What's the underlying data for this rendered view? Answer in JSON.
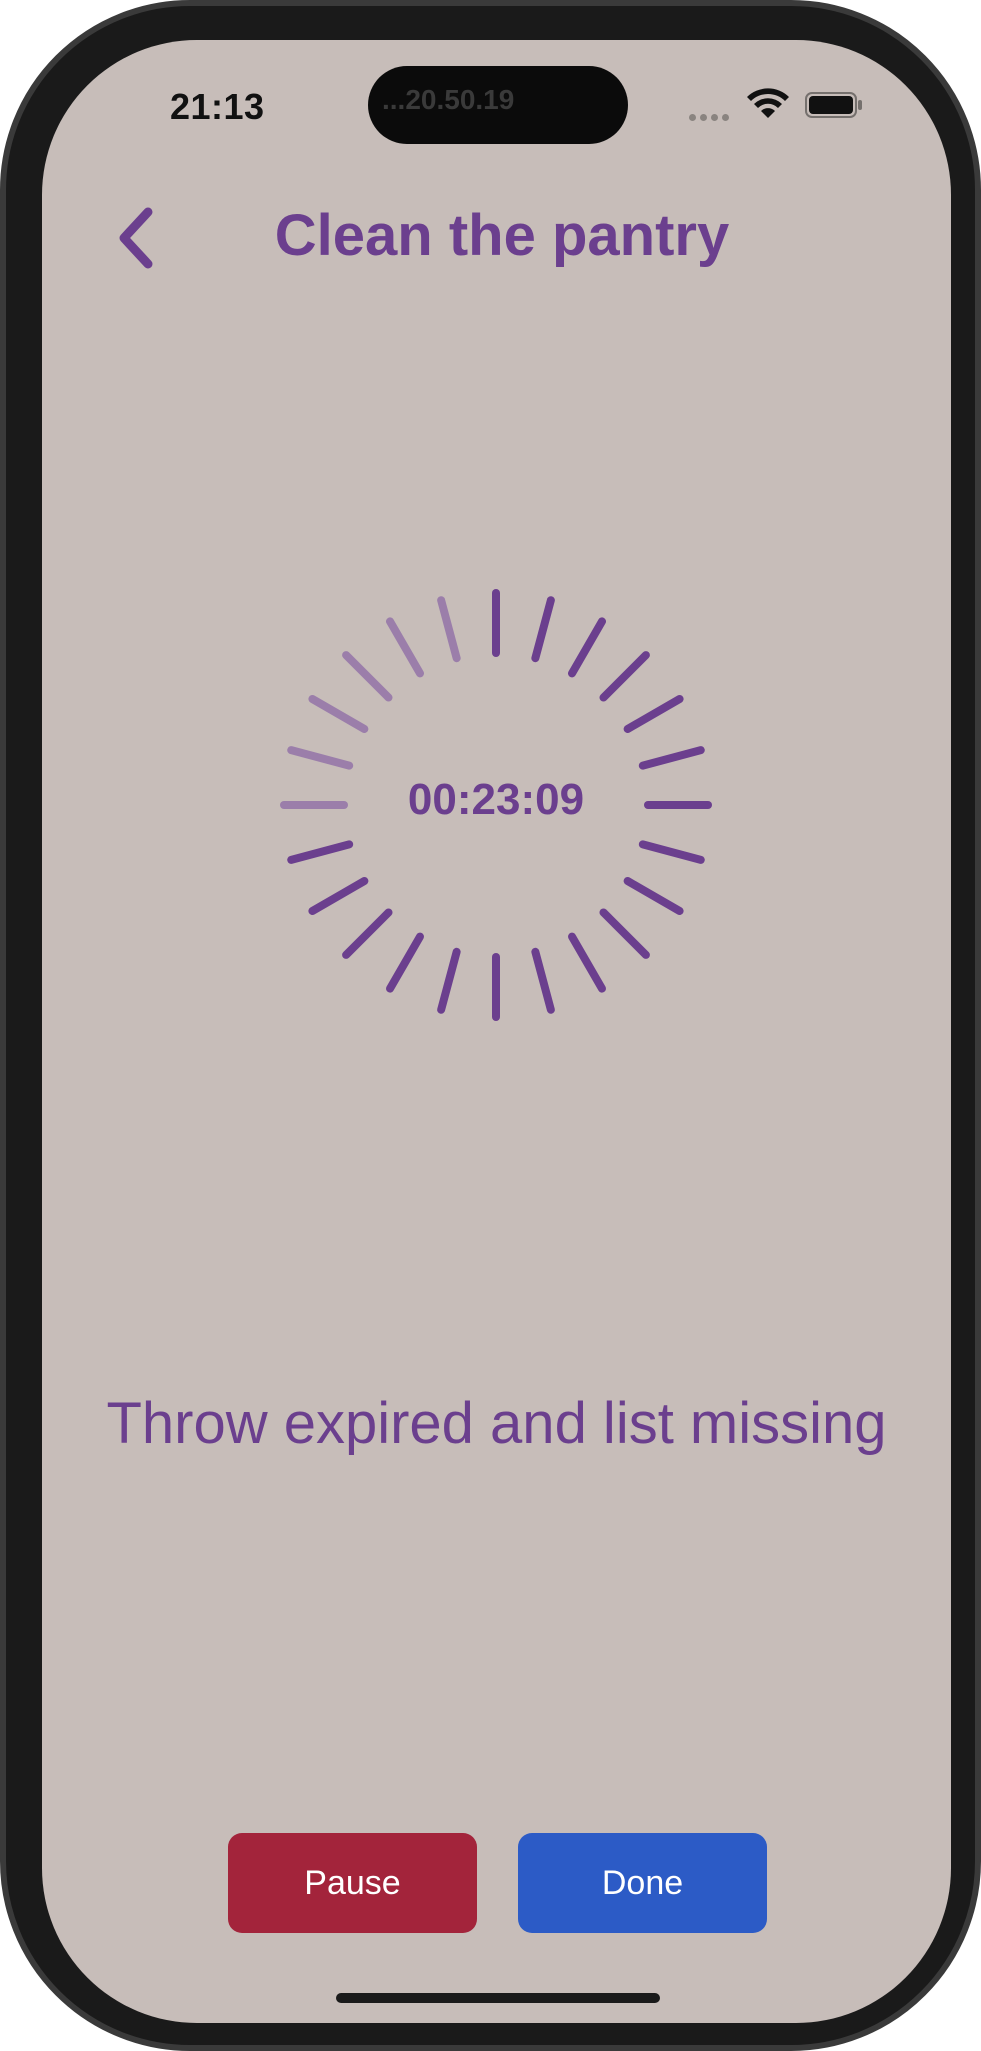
{
  "status_bar": {
    "time": "21:13",
    "island_text": "...20.50.19"
  },
  "header": {
    "back_icon": "chevron-left-icon",
    "title": "Clean the pantry"
  },
  "timer": {
    "display": "00:23:09",
    "tick_count": 24,
    "faded_ticks": 6,
    "color": "#6b3f8e",
    "faded_color": "#8c6aa5"
  },
  "task": {
    "text": "Throw expired and list missing"
  },
  "actions": {
    "pause_label": "Pause",
    "done_label": "Done",
    "pause_color": "#a3243b",
    "done_color": "#2c5bc6"
  },
  "colors": {
    "background": "#c7bdb9",
    "accent": "#6b3f8e"
  }
}
